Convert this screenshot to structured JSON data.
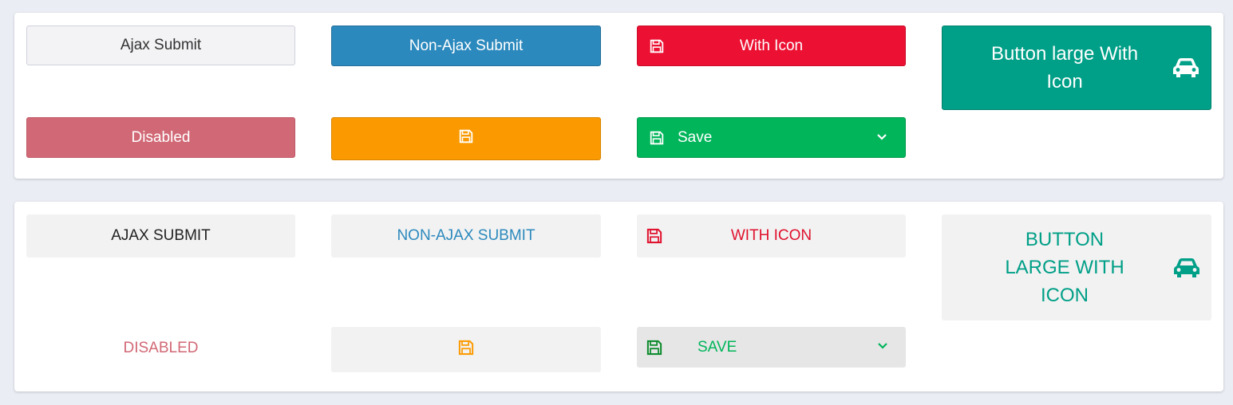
{
  "standard_buttons": {
    "ajax_submit": "Ajax Submit",
    "non_ajax_submit": "Non-Ajax Submit",
    "with_icon": "With Icon",
    "large_with_icon": "Button large With Icon",
    "disabled": "Disabled",
    "save": "Save"
  },
  "flat_buttons": {
    "ajax_submit": "Ajax Submit",
    "non_ajax_submit": "Non-Ajax Submit",
    "with_icon": "With Icon",
    "large_with_icon": "Button large With Icon",
    "disabled": "Disabled",
    "save": "Save"
  },
  "icons": {
    "save": "floppy-disk-icon",
    "car": "car-icon",
    "dropdown": "chevron-down-icon"
  },
  "colors": {
    "default": "#f3f3f5",
    "primary": "#2c89bd",
    "danger": "#ec1133",
    "teal": "#009f87",
    "disabled": "#d16875",
    "warning": "#fb9a00",
    "success": "#00b55a"
  }
}
